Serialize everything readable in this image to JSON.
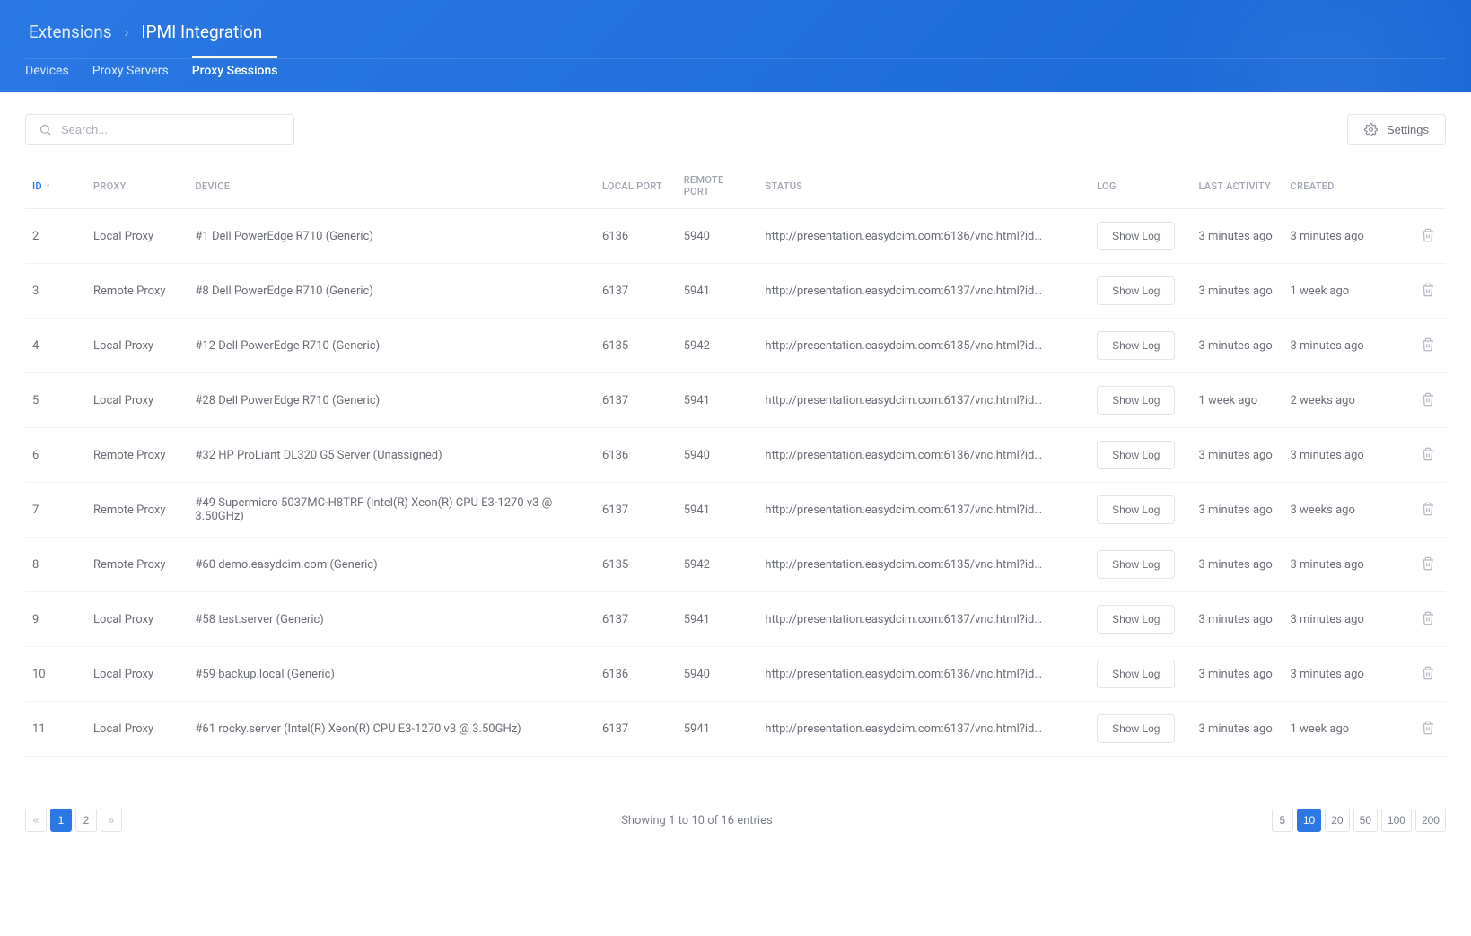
{
  "breadcrumb": {
    "root": "Extensions",
    "current": "IPMI Integration"
  },
  "tabs": [
    {
      "label": "Devices",
      "active": false
    },
    {
      "label": "Proxy Servers",
      "active": false
    },
    {
      "label": "Proxy Sessions",
      "active": true
    }
  ],
  "search": {
    "placeholder": "Search..."
  },
  "settings_label": "Settings",
  "columns": {
    "id": "ID",
    "proxy": "PROXY",
    "device": "DEVICE",
    "local_port": "LOCAL PORT",
    "remote_port": "REMOTE PORT",
    "status": "STATUS",
    "log": "LOG",
    "last_activity": "LAST ACTIVITY",
    "created": "CREATED"
  },
  "log_button_label": "Show Log",
  "rows": [
    {
      "id": "2",
      "proxy": "Local Proxy",
      "device": "#1 Dell PowerEdge R710 (Generic)",
      "local_port": "6136",
      "remote_port": "5940",
      "status": "http://presentation.easydcim.com:6136/vnc.html?id=...",
      "last_activity": "3 minutes ago",
      "created": "3 minutes ago"
    },
    {
      "id": "3",
      "proxy": "Remote Proxy",
      "device": "#8 Dell PowerEdge R710 (Generic)",
      "local_port": "6137",
      "remote_port": "5941",
      "status": "http://presentation.easydcim.com:6137/vnc.html?id=...",
      "last_activity": "3 minutes ago",
      "created": "1 week ago"
    },
    {
      "id": "4",
      "proxy": "Local Proxy",
      "device": "#12 Dell PowerEdge R710 (Generic)",
      "local_port": "6135",
      "remote_port": "5942",
      "status": "http://presentation.easydcim.com:6135/vnc.html?id=...",
      "last_activity": "3 minutes ago",
      "created": "3 minutes ago"
    },
    {
      "id": "5",
      "proxy": "Local Proxy",
      "device": "#28 Dell PowerEdge R710 (Generic)",
      "local_port": "6137",
      "remote_port": "5941",
      "status": "http://presentation.easydcim.com:6137/vnc.html?id=...",
      "last_activity": "1 week ago",
      "created": "2 weeks ago"
    },
    {
      "id": "6",
      "proxy": "Remote Proxy",
      "device": "#32 HP ProLiant DL320 G5 Server (Unassigned)",
      "local_port": "6136",
      "remote_port": "5940",
      "status": "http://presentation.easydcim.com:6136/vnc.html?id=...",
      "last_activity": "3 minutes ago",
      "created": "3 minutes ago"
    },
    {
      "id": "7",
      "proxy": "Remote Proxy",
      "device": "#49 Supermicro 5037MC-H8TRF (Intel(R) Xeon(R) CPU E3-1270 v3 @ 3.50GHz)",
      "local_port": "6137",
      "remote_port": "5941",
      "status": "http://presentation.easydcim.com:6137/vnc.html?id=...",
      "last_activity": "3 minutes ago",
      "created": "3 weeks ago"
    },
    {
      "id": "8",
      "proxy": "Remote Proxy",
      "device": "#60 demo.easydcim.com (Generic)",
      "local_port": "6135",
      "remote_port": "5942",
      "status": "http://presentation.easydcim.com:6135/vnc.html?id=...",
      "last_activity": "3 minutes ago",
      "created": "3 minutes ago"
    },
    {
      "id": "9",
      "proxy": "Local Proxy",
      "device": "#58 test.server (Generic)",
      "local_port": "6137",
      "remote_port": "5941",
      "status": "http://presentation.easydcim.com:6137/vnc.html?id=...",
      "last_activity": "3 minutes ago",
      "created": "3 minutes ago"
    },
    {
      "id": "10",
      "proxy": "Local Proxy",
      "device": "#59 backup.local (Generic)",
      "local_port": "6136",
      "remote_port": "5940",
      "status": "http://presentation.easydcim.com:6136/vnc.html?id=...",
      "last_activity": "3 minutes ago",
      "created": "3 minutes ago"
    },
    {
      "id": "11",
      "proxy": "Local Proxy",
      "device": "#61 rocky.server (Intel(R) Xeon(R) CPU E3-1270 v3 @ 3.50GHz)",
      "local_port": "6137",
      "remote_port": "5941",
      "status": "http://presentation.easydcim.com:6137/vnc.html?id=...",
      "last_activity": "3 minutes ago",
      "created": "1 week ago"
    }
  ],
  "pagination": {
    "pages": [
      "1",
      "2"
    ],
    "active_page": "1",
    "summary": "Showing 1 to 10 of 16 entries",
    "sizes": [
      "5",
      "10",
      "20",
      "50",
      "100",
      "200"
    ],
    "active_size": "10"
  }
}
